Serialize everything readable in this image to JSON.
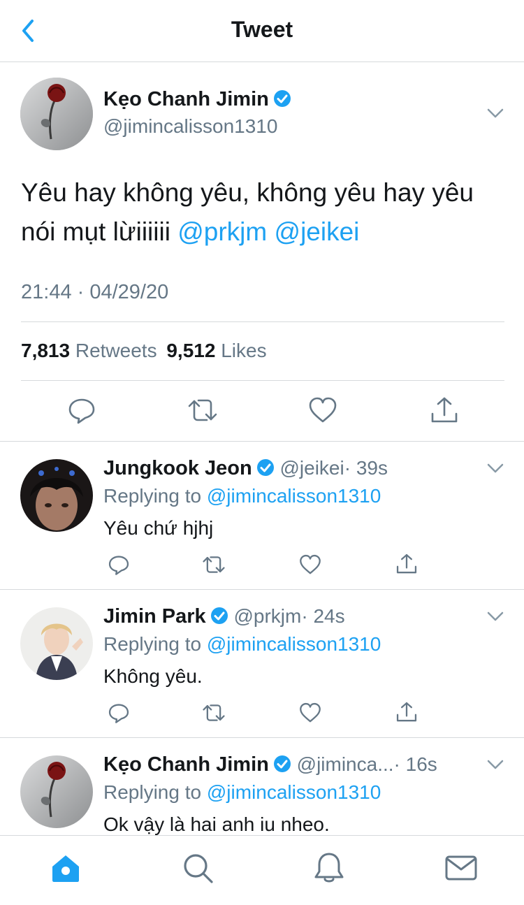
{
  "header": {
    "title": "Tweet"
  },
  "main_tweet": {
    "display_name": "Kẹo Chanh Jimin",
    "handle": "@jimincalisson1310",
    "text": "Yêu hay không yêu, không yêu hay yêu nói mụt lừiiiiii",
    "mentions": [
      "@prkjm",
      "@jeikei"
    ],
    "timestamp": "21:44 · 04/29/20",
    "retweets_count": "7,813",
    "retweets_label": "Retweets",
    "likes_count": "9,512",
    "likes_label": "Likes"
  },
  "replies": [
    {
      "display_name": "Jungkook Jeon",
      "handle": "@jeikei",
      "time": "· 39s",
      "replying_to_label": "Replying to",
      "replying_to": "@jimincalisson1310",
      "text": "Yêu chứ hjhj"
    },
    {
      "display_name": "Jimin Park",
      "handle": "@prkjm",
      "time": "· 24s",
      "replying_to_label": "Replying to",
      "replying_to": "@jimincalisson1310",
      "text": "Không yêu."
    },
    {
      "display_name": "Kẹo Chanh Jimin",
      "handle": "@jiminca...",
      "time": "· 16s",
      "replying_to_label": "Replying to",
      "replying_to": "@jimincalisson1310",
      "text": "Ok vậy là hai anh iu nheo."
    }
  ],
  "tabbar": [
    "home-icon",
    "search-icon",
    "notifications-icon",
    "messages-icon"
  ],
  "colors": {
    "accent": "#1da1f2",
    "text": "#14171a",
    "secondary": "#657786",
    "divider": "#d6d9dc",
    "icon": "#657786"
  }
}
